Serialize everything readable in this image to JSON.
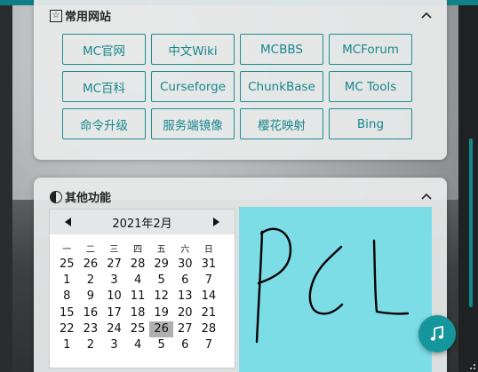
{
  "sections": {
    "common_sites": {
      "title": "常用网站",
      "icon": "star-box-icon",
      "buttons": [
        "MC官网",
        "中文Wiki",
        "MCBBS",
        "MCForum",
        "MC百科",
        "Curseforge",
        "ChunkBase",
        "MC Tools",
        "命令升级",
        "服务端镜像",
        "樱花映射",
        "Bing"
      ]
    },
    "other_features": {
      "title": "其他功能",
      "icon": "half-circle-icon",
      "calendar": {
        "title": "2021年2月",
        "weekdays": [
          "一",
          "二",
          "三",
          "四",
          "五",
          "六",
          "日"
        ],
        "weeks": [
          [
            "25",
            "26",
            "27",
            "28",
            "29",
            "30",
            "31"
          ],
          [
            "1",
            "2",
            "3",
            "4",
            "5",
            "6",
            "7"
          ],
          [
            "8",
            "9",
            "10",
            "11",
            "12",
            "13",
            "14"
          ],
          [
            "15",
            "16",
            "17",
            "18",
            "19",
            "20",
            "21"
          ],
          [
            "22",
            "23",
            "24",
            "25",
            "26",
            "27",
            "28"
          ],
          [
            "1",
            "2",
            "3",
            "4",
            "5",
            "6",
            "7"
          ]
        ],
        "selected_day": "26"
      },
      "drawing_text": "PCL"
    }
  },
  "fab_icon": "music-note-icon",
  "colors": {
    "accent": "#17868c",
    "fab": "#15969c",
    "drawing_bg": "#7ddde7",
    "selected_day_bg": "#b0b0b0"
  }
}
